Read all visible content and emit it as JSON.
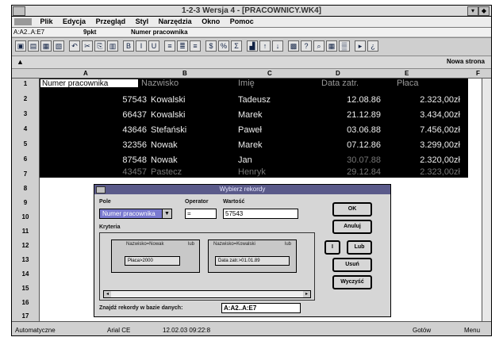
{
  "window": {
    "title": "1-2-3 Wersja 4 - [PRACOWNICY.WK4]",
    "minimize": "▾",
    "restore": "◆"
  },
  "menu": [
    "Plik",
    "Edycja",
    "Przegląd",
    "Styl",
    "Narzędzia",
    "Okno",
    "Pomoc"
  ],
  "formula": {
    "address": "A:A2..A:E7",
    "style": "9pkt",
    "content": "Numer pracownika"
  },
  "sheet": {
    "tab_label": "Nowa strona"
  },
  "columns": [
    "A",
    "B",
    "C",
    "D",
    "E",
    "F"
  ],
  "rows": [
    "1",
    "2",
    "3",
    "4",
    "5",
    "6",
    "7",
    "8",
    "9",
    "10",
    "11",
    "12",
    "13",
    "14",
    "15",
    "16",
    "17"
  ],
  "table": {
    "header": [
      "Numer pracownika",
      "Nazwisko",
      "Imię",
      "Data zatr.",
      "Płaca"
    ],
    "rows": [
      [
        "57543",
        "Kowalski",
        "Tadeusz",
        "12.08.86",
        "2.323,00zł"
      ],
      [
        "66437",
        "Kowalski",
        "Marek",
        "21.12.89",
        "3.434,00zł"
      ],
      [
        "43646",
        "Stefański",
        "Paweł",
        "03.06.88",
        "7.456,00zł"
      ],
      [
        "32356",
        "Nowak",
        "Marek",
        "07.12.86",
        "3.299,00zł"
      ],
      [
        "87548",
        "Nowak",
        "Jan",
        "30.07.88",
        "2.320,00zł"
      ],
      [
        "43457",
        "Pastecz",
        "Henryk",
        "29.12.84",
        "2.323,00zł"
      ]
    ]
  },
  "dialog": {
    "title": "Wybierz rekordy",
    "field_label": "Pole",
    "field_value": "Numer pracownika",
    "operator_label": "Operator",
    "operator_value": "=",
    "value_label": "Wartość",
    "value_value": "57543",
    "criteria_label": "Kryteria",
    "pane1_title": "Nazwisko=Nowak",
    "pane1_op": "lub",
    "pane1_value": "Płaca>2000",
    "pane2_title": "Nazwisko=Kowalski",
    "pane2_op": "lub",
    "pane2_value": "Data zatr.>01.01.89",
    "ok": "OK",
    "cancel": "Anuluj",
    "and": "I",
    "or": "Lub",
    "clear": "Usuń",
    "clear_all": "Wyczyść",
    "extract_label": "Znajdź rekordy w bazie danych:",
    "extract_value": "A:A2..A:E7"
  },
  "status": {
    "left": "Automatyczne",
    "font": "Arial CE",
    "date": "12.02.03 09:22:8",
    "mode": "Gotów",
    "right": "Menu"
  }
}
